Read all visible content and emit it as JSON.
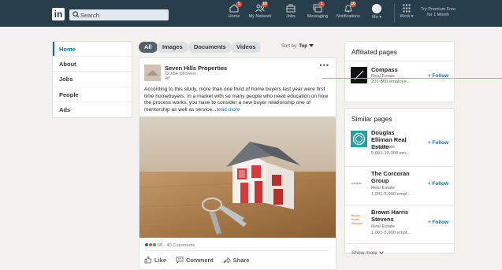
{
  "nav": {
    "logo": "in",
    "search_placeholder": "Search",
    "items": [
      {
        "label": "Home",
        "icon": "home-icon",
        "badge": "1"
      },
      {
        "label": "My Network",
        "icon": "network-icon",
        "badge": "10"
      },
      {
        "label": "Jobs",
        "icon": "jobs-icon",
        "badge": ""
      },
      {
        "label": "Messaging",
        "icon": "messaging-icon",
        "badge": "1"
      },
      {
        "label": "Notifications",
        "icon": "bell-icon",
        "badge": "10"
      },
      {
        "label": "Me ▾",
        "icon": "avatar",
        "badge": ""
      },
      {
        "label": "Work ▾",
        "icon": "grid-icon",
        "badge": ""
      }
    ],
    "premium_line1": "Try Premium Free",
    "premium_line2": "for 1 Month"
  },
  "sidebar": {
    "items": [
      {
        "label": "Home"
      },
      {
        "label": "About"
      },
      {
        "label": "Jobs"
      },
      {
        "label": "People"
      },
      {
        "label": "Ads"
      }
    ]
  },
  "filters": {
    "items": [
      {
        "label": "All"
      },
      {
        "label": "Images"
      },
      {
        "label": "Documents"
      },
      {
        "label": "Videos"
      }
    ],
    "sort_prefix": "Sort by:",
    "sort_value": "Top"
  },
  "post": {
    "author": "Seven Hills Properties",
    "followers": "12,654 followers",
    "time": "4d",
    "more": "•••",
    "text": "According to this study, more than one third of home buyers last year were first time homebuyers. In a market with so many people who need education on how the process works, you have to consider a new buyer relationship one of mentorship as well as service...",
    "read_more": "read more",
    "reactions": "98 - 40 Comments",
    "like": "Like",
    "comment": "Comment",
    "share": "Share"
  },
  "affiliated": {
    "title": "Affiliated pages",
    "companies": [
      {
        "name": "Compass",
        "industry": "Real Estate",
        "size": "201-500 employe...",
        "follow": "+ Follow"
      }
    ]
  },
  "similar": {
    "title": "Similar pages",
    "companies": [
      {
        "name": "Douglas Elliman Real Estate",
        "industry": "Real Estate",
        "size": "5,001-10,000 em...",
        "follow": "+ Follow",
        "logo_text": "DE"
      },
      {
        "name": "The Corcoran Group",
        "industry": "Real Estate",
        "size": "1,001-5,000 empl...",
        "follow": "+ Follow",
        "logo_text": "corcoran"
      },
      {
        "name": "Brown Harris Stevens",
        "industry": "Real Estate",
        "size": "1,001-5,000 empl...",
        "follow": "+ Follow",
        "logo_text": "Brown Harris Stevens"
      }
    ],
    "show_more": "Show more"
  },
  "colors": {
    "brand": "#0073b1",
    "topbar": "#283e4a",
    "accent_line": "#e8a23a"
  }
}
